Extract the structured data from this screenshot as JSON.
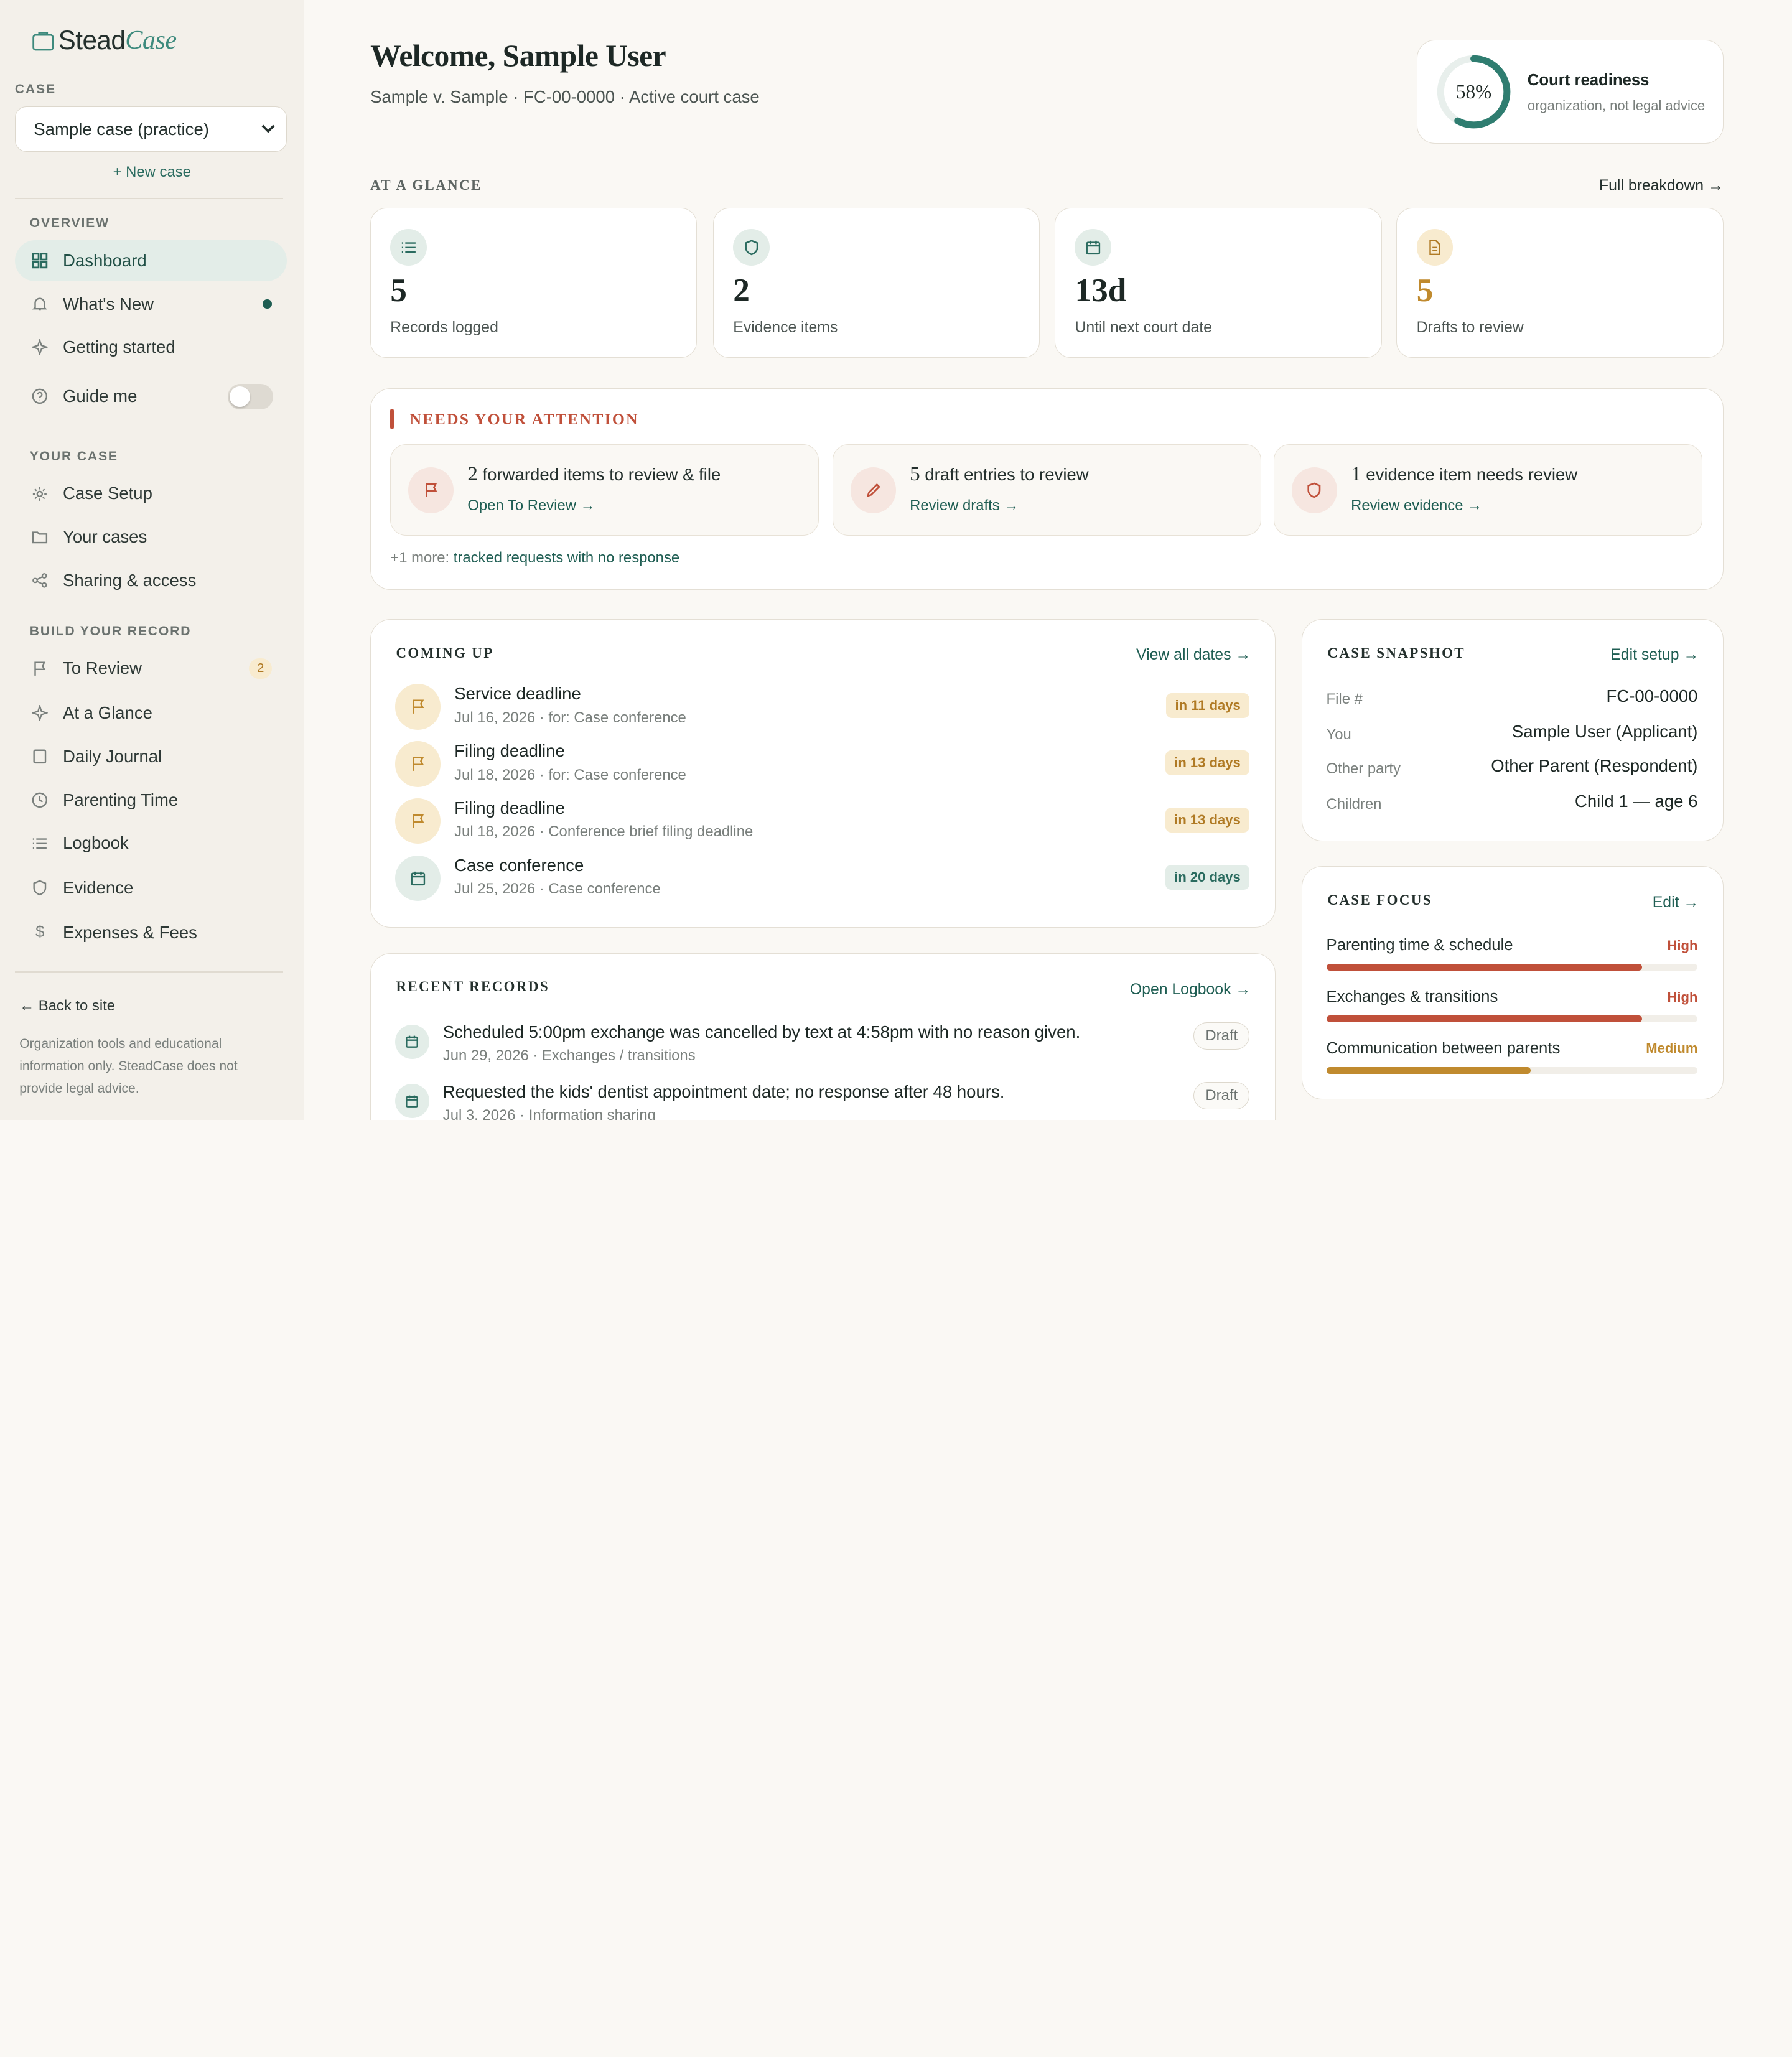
{
  "brand": {
    "name_a": "Stead",
    "name_b": "Case"
  },
  "sidebar": {
    "case_label": "CASE",
    "case_select": "Sample case (practice)",
    "new_case": "+ New case",
    "overview_label": "OVERVIEW",
    "overview_items": [
      {
        "label": "Dashboard",
        "icon": "grid-icon"
      },
      {
        "label": "What's New",
        "icon": "bell-icon"
      },
      {
        "label": "Getting started",
        "icon": "sparkle-icon"
      },
      {
        "label": "Guide me",
        "icon": "help-circle-icon"
      }
    ],
    "your_case_label": "YOUR CASE",
    "your_case_items": [
      {
        "label": "Case Setup",
        "icon": "gear-icon"
      },
      {
        "label": "Your cases",
        "icon": "folder-icon"
      },
      {
        "label": "Sharing & access",
        "icon": "share-icon"
      }
    ],
    "build_label": "BUILD YOUR RECORD",
    "build_items": [
      {
        "label": "To Review",
        "icon": "flag-icon",
        "badge": "2"
      },
      {
        "label": "At a Glance",
        "icon": "sparkle-icon"
      },
      {
        "label": "Daily Journal",
        "icon": "book-icon"
      },
      {
        "label": "Parenting Time",
        "icon": "clock-icon"
      },
      {
        "label": "Logbook",
        "icon": "list-icon"
      },
      {
        "label": "Evidence",
        "icon": "shield-icon"
      },
      {
        "label": "Expenses & Fees",
        "icon": "dollar-icon"
      }
    ],
    "back_link": "← Back to site",
    "disclaimer": "Organization tools and educational information only. SteadCase does not provide legal advice."
  },
  "header": {
    "title": "Welcome, Sample User",
    "subtitle": "Sample v. Sample · FC-00-0000 · Active court case",
    "readiness": {
      "percent_label": "58%",
      "percent": 58,
      "title": "Court readiness",
      "note": "organization, not legal advice"
    }
  },
  "glance": {
    "label": "AT A GLANCE",
    "link": "Full breakdown →",
    "stats": [
      {
        "value": "5",
        "label": "Records logged",
        "icon": "list-icon"
      },
      {
        "value": "2",
        "label": "Evidence items",
        "icon": "shield-icon"
      },
      {
        "value": "13d",
        "label": "Until next court date",
        "icon": "calendar-icon"
      },
      {
        "value": "5",
        "label": "Drafts to review",
        "icon": "document-icon"
      }
    ]
  },
  "attention": {
    "label": "NEEDS YOUR ATTENTION",
    "items": [
      {
        "count": "2",
        "text": "forwarded items to review & file",
        "link": "Open To Review →",
        "icon": "flag-icon"
      },
      {
        "count": "5",
        "text": "draft entries to review",
        "link": "Review drafts →",
        "icon": "pencil-icon"
      },
      {
        "count": "1",
        "text": "evidence item needs review",
        "link": "Review evidence →",
        "icon": "shield-icon"
      }
    ],
    "more_prefix": "+1 more:",
    "more_link": "tracked requests with no response"
  },
  "coming_up": {
    "label": "COMING UP",
    "link": "View all dates →",
    "items": [
      {
        "title": "Service deadline",
        "sub": "Jul 16, 2026 · for: Case conference",
        "pill": "in 11 days",
        "icon": "flag-icon"
      },
      {
        "title": "Filing deadline",
        "sub": "Jul 18, 2026 · for: Case conference",
        "pill": "in 13 days",
        "icon": "flag-icon"
      },
      {
        "title": "Filing deadline",
        "sub": "Jul 18, 2026 · Conference brief filing deadline",
        "pill": "in 13 days",
        "icon": "flag-icon"
      },
      {
        "title": "Case conference",
        "sub": "Jul 25, 2026 · Case conference",
        "pill": "in 20 days",
        "icon": "calendar-icon"
      }
    ]
  },
  "snapshot": {
    "label": "CASE SNAPSHOT",
    "link": "Edit setup →",
    "rows": [
      {
        "k": "File #",
        "v": "FC-00-0000"
      },
      {
        "k": "You",
        "v": "Sample User (Applicant)"
      },
      {
        "k": "Other party",
        "v": "Other Parent (Respondent)"
      },
      {
        "k": "Children",
        "v": "Child 1 — age 6"
      }
    ]
  },
  "focus": {
    "label": "CASE FOCUS",
    "link": "Edit →",
    "items": [
      {
        "k": "Parenting time & schedule",
        "level": "High",
        "fill": 0.85,
        "color": "#c0503a"
      },
      {
        "k": "Exchanges & transitions",
        "level": "High",
        "fill": 0.85,
        "color": "#c0503a"
      },
      {
        "k": "Communication between parents",
        "level": "Medium",
        "fill": 0.55,
        "color": "#c08a2e"
      }
    ]
  },
  "records": {
    "label": "RECENT RECORDS",
    "link": "Open Logbook →",
    "items": [
      {
        "title": "Scheduled 5:00pm exchange was cancelled by text at 4:58pm with no reason given.",
        "sub": "Jun 29, 2026 · Exchanges / transitions",
        "pill": "Draft"
      },
      {
        "title": "Requested the kids' dentist appointment date; no response after 48 hours.",
        "sub": "Jul 3, 2026 · Information sharing",
        "pill": "Draft"
      }
    ]
  },
  "colors": {
    "accent": "#1f5e53",
    "alert": "#c0503a",
    "warn": "#c08a2e",
    "bg": "#faf8f4"
  }
}
